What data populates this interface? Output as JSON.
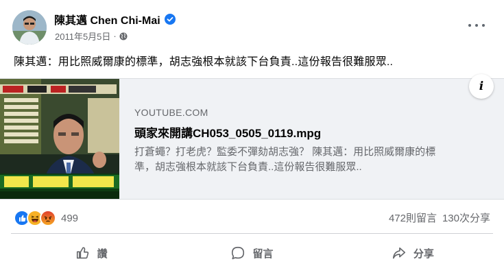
{
  "post": {
    "author": "陳其邁 Chen Chi-Mai",
    "date": "2011年5月5日",
    "separator": "·",
    "privacy_icon": "globe-icon",
    "text": "陳其邁：用比照威爾康的標準，胡志強根本就該下台負責..這份報告很難服眾.."
  },
  "link_card": {
    "domain": "YOUTUBE.COM",
    "title": "頭家來開講CH053_0505_0119.mpg",
    "description": "打蒼蠅？打老虎？監委不彈劾胡志強？ 陳其邁：用比照威爾康的標準，胡志強根本就該下台負責..這份報告很難服眾..",
    "info_icon": "i"
  },
  "stats": {
    "reaction_count": "499",
    "comments": "472則留言",
    "shares": "130次分享",
    "reactions": [
      "like",
      "haha",
      "angry"
    ]
  },
  "actions": {
    "like_label": "讚",
    "comment_label": "留言",
    "share_label": "分享"
  },
  "colors": {
    "like_blue": "#1877f2",
    "haha_yellow": "#f7b125",
    "angry_orange": "#e9710f",
    "muted_text": "#65676b",
    "card_bg": "#f0f2f5"
  }
}
